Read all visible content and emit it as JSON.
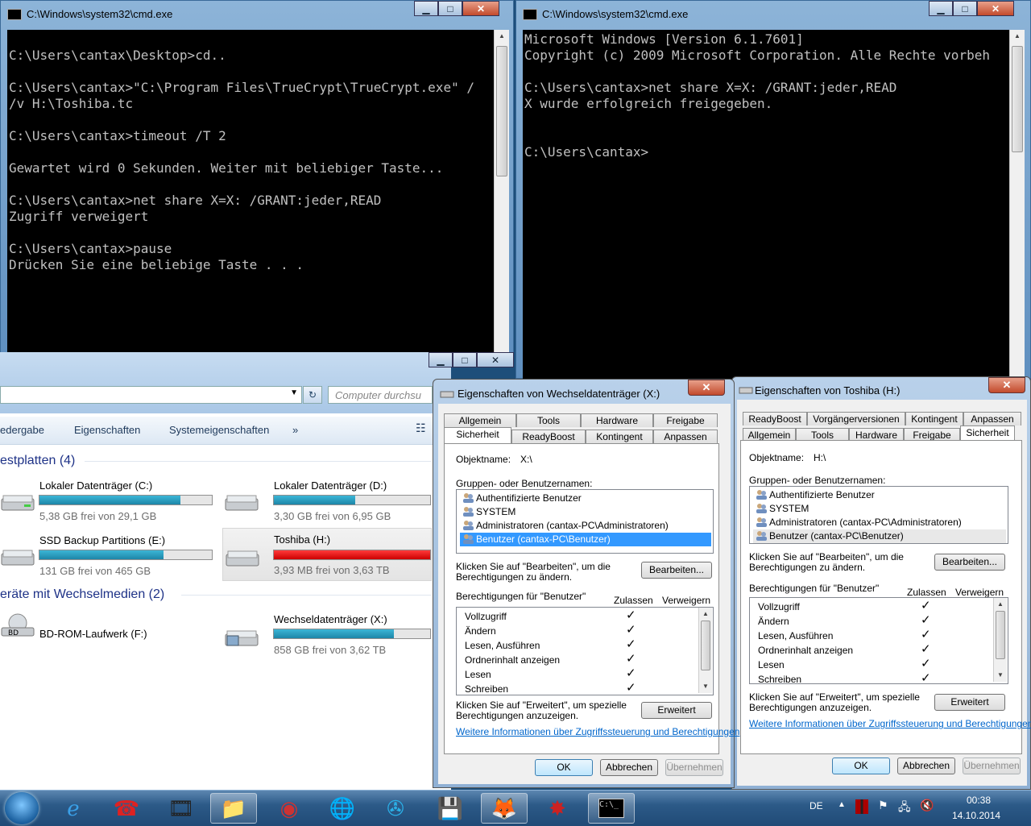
{
  "cmd1": {
    "title": "C:\\Windows\\system32\\cmd.exe",
    "lines": "\nC:\\Users\\cantax\\Desktop>cd..\n\nC:\\Users\\cantax>\"C:\\Program Files\\TrueCrypt\\TrueCrypt.exe\" /\n/v H:\\Toshiba.tc\n\nC:\\Users\\cantax>timeout /T 2\n\nGewartet wird 0 Sekunden. Weiter mit beliebiger Taste...\n\nC:\\Users\\cantax>net share X=X: /GRANT:jeder,READ\nZugriff verweigert\n\nC:\\Users\\cantax>pause\nDrücken Sie eine beliebige Taste . . ."
  },
  "cmd2": {
    "title": "C:\\Windows\\system32\\cmd.exe",
    "lines": "Microsoft Windows [Version 6.1.7601]\nCopyright (c) 2009 Microsoft Corporation. Alle Rechte vorbeh\n\nC:\\Users\\cantax>net share X=X: /GRANT:jeder,READ\nX wurde erfolgreich freigegeben.\n\n\nC:\\Users\\cantax>"
  },
  "explorer": {
    "search_placeholder": "Computer durchsu",
    "cmdbar": {
      "item1": "edergabe",
      "item2": "Eigenschaften",
      "item3": "Systemeigenschaften",
      "more": "»"
    },
    "group_hdd": "estplatten (4)",
    "group_removable": "eräte mit Wechselmedien (2)",
    "drives": [
      {
        "name": "Lokaler Datenträger (C:)",
        "free": "5,38 GB frei von 29,1 GB",
        "used_fraction": 0.82
      },
      {
        "name": "Lokaler Datenträger (D:)",
        "free": "3,30 GB frei von 6,95 GB",
        "used_fraction": 0.52
      },
      {
        "name": "SSD Backup Partitions (E:)",
        "free": "131 GB frei von 465 GB",
        "used_fraction": 0.72
      },
      {
        "name": "Toshiba (H:)",
        "free": "3,93 MB frei von 3,63 TB",
        "used_fraction": 1.0
      },
      {
        "name": "BD-ROM-Laufwerk (F:)"
      },
      {
        "name": "Wechseldatenträger (X:)",
        "free": "858 GB frei von 3,62 TB",
        "used_fraction": 0.77
      }
    ]
  },
  "dialog1": {
    "title": "Eigenschaften von Wechseldatenträger (X:)",
    "tabs_row1": [
      "Allgemein",
      "Tools",
      "Hardware",
      "Freigabe"
    ],
    "tabs_row2": [
      "Sicherheit",
      "ReadyBoost",
      "Kontingent",
      "Anpassen"
    ],
    "object_label": "Objektname:",
    "object_value": "X:\\",
    "groups_label": "Gruppen- oder Benutzernamen:",
    "users": [
      "Authentifizierte Benutzer",
      "SYSTEM",
      "Administratoren (cantax-PC\\Administratoren)",
      "Benutzer (cantax-PC\\Benutzer)"
    ],
    "edit_hint": "Klicken Sie auf \"Bearbeiten\", um die\nBerechtigungen zu ändern.",
    "edit_btn": "Bearbeiten...",
    "perm_label": "Berechtigungen für \"Benutzer\"",
    "allow": "Zulassen",
    "deny": "Verweigern",
    "perms": [
      "Vollzugriff",
      "Ändern",
      "Lesen, Ausführen",
      "Ordnerinhalt anzeigen",
      "Lesen",
      "Schreiben"
    ],
    "check": "✓",
    "adv_hint": "Klicken Sie auf \"Erweitert\", um spezielle\nBerechtigungen anzuzeigen.",
    "adv_btn": "Erweitert",
    "link": "Weitere Informationen über Zugriffssteuerung und Berechtigungen",
    "ok": "OK",
    "cancel": "Abbrechen",
    "apply": "Übernehmen"
  },
  "dialog2": {
    "title": "Eigenschaften von Toshiba (H:)",
    "tabs_row1": [
      "ReadyBoost",
      "Vorgängerversionen",
      "Kontingent",
      "Anpassen"
    ],
    "tabs_row2": [
      "Allgemein",
      "Tools",
      "Hardware",
      "Freigabe",
      "Sicherheit"
    ],
    "object_label": "Objektname:",
    "object_value": "H:\\",
    "groups_label": "Gruppen- oder Benutzernamen:",
    "users": [
      "Authentifizierte Benutzer",
      "SYSTEM",
      "Administratoren (cantax-PC\\Administratoren)",
      "Benutzer (cantax-PC\\Benutzer)"
    ],
    "edit_hint": "Klicken Sie auf \"Bearbeiten\", um die\nBerechtigungen zu ändern.",
    "edit_btn": "Bearbeiten...",
    "perm_label": "Berechtigungen für \"Benutzer\"",
    "allow": "Zulassen",
    "deny": "Verweigern",
    "perms": [
      "Vollzugriff",
      "Ändern",
      "Lesen, Ausführen",
      "Ordnerinhalt anzeigen",
      "Lesen",
      "Schreiben"
    ],
    "check": "✓",
    "adv_hint": "Klicken Sie auf \"Erweitert\", um spezielle\nBerechtigungen anzuzeigen.",
    "adv_btn": "Erweitert",
    "link": "Weitere Informationen über Zugriffssteuerung und Berechtigungen",
    "ok": "OK",
    "cancel": "Abbrechen",
    "apply": "Übernehmen"
  },
  "taskbar": {
    "icons": [
      "ie-icon",
      "network-icon",
      "video-icon",
      "explorer-icon",
      "media-icon",
      "world-icon",
      "app-icon",
      "save-icon",
      "firefox-icon",
      "game-icon",
      "cmd-icon"
    ],
    "lang": "DE",
    "time": "00:38",
    "date": "14.10.2014"
  }
}
